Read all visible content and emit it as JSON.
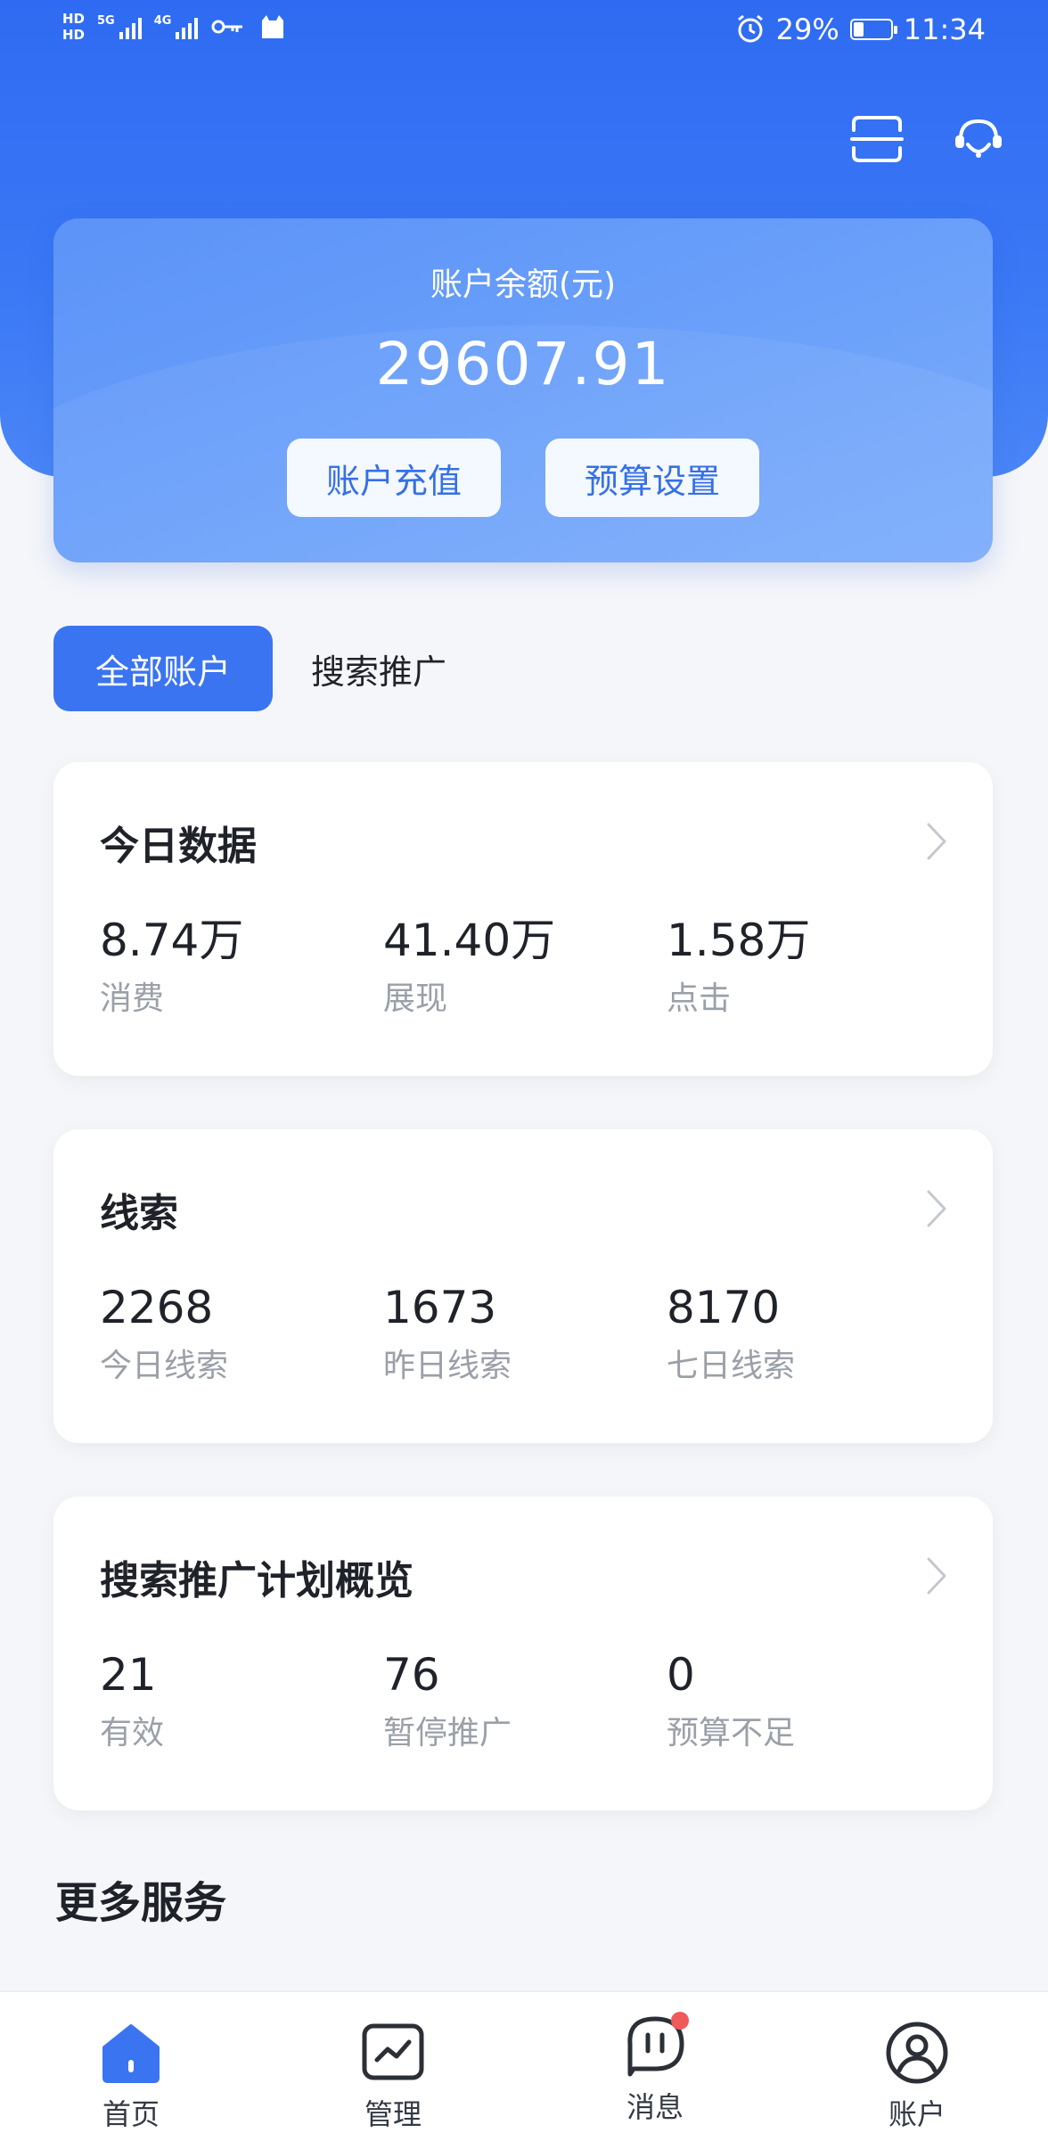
{
  "status_bar": {
    "hd_top": "HD",
    "hd_bottom": "HD",
    "signal1_label": "5G",
    "signal2_label": "4G",
    "battery": "29%",
    "battery_level": 0.29,
    "time": "11:34",
    "icons": [
      "key-icon",
      "cat-icon",
      "alarm-icon",
      "battery-icon"
    ]
  },
  "header": {
    "icons": [
      "scan-icon",
      "customer-service-icon"
    ]
  },
  "balance": {
    "label": "账户余额(元)",
    "value": "29607.91",
    "recharge_label": "账户充值",
    "budget_label": "预算设置"
  },
  "tabs": [
    {
      "label": "全部账户",
      "active": true
    },
    {
      "label": "搜索推广",
      "active": false
    }
  ],
  "cards": {
    "today": {
      "title": "今日数据",
      "metrics": [
        {
          "value": "8.74万",
          "label": "消费"
        },
        {
          "value": "41.40万",
          "label": "展现"
        },
        {
          "value": "1.58万",
          "label": "点击"
        }
      ]
    },
    "leads": {
      "title": "线索",
      "metrics": [
        {
          "value": "2268",
          "label": "今日线索"
        },
        {
          "value": "1673",
          "label": "昨日线索"
        },
        {
          "value": "8170",
          "label": "七日线索"
        }
      ]
    },
    "plan": {
      "title": "搜索推广计划概览",
      "metrics": [
        {
          "value": "21",
          "label": "有效"
        },
        {
          "value": "76",
          "label": "暂停推广"
        },
        {
          "value": "0",
          "label": "预算不足"
        }
      ]
    }
  },
  "more_services": {
    "title": "更多服务"
  },
  "bottom_nav": [
    {
      "label": "首页",
      "icon": "home-icon",
      "active": true
    },
    {
      "label": "管理",
      "icon": "chart-icon",
      "active": false
    },
    {
      "label": "消息",
      "icon": "message-icon",
      "active": false,
      "badge": true
    },
    {
      "label": "账户",
      "icon": "user-icon",
      "active": false
    }
  ],
  "colors": {
    "primary": "#3a74f1",
    "header_blue": "#2f6bf2",
    "card_blue": "#6aa0fa",
    "badge_red": "#f05a5a",
    "muted_text": "#9aa0a8"
  }
}
